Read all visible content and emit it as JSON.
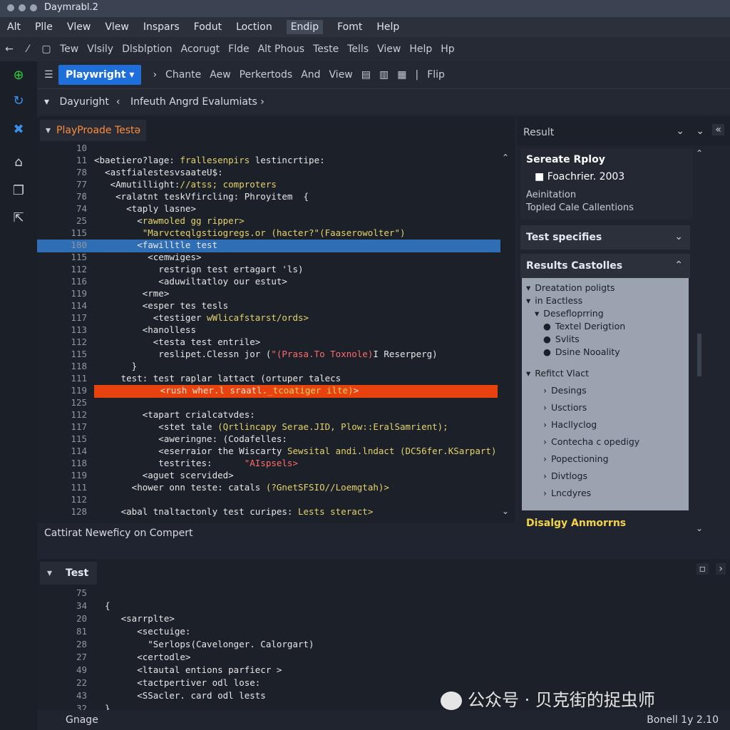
{
  "window": {
    "title": "Daymrabl.2"
  },
  "menu": [
    "Alt",
    "Plle",
    "Vlew",
    "Vlew",
    "Inspars",
    "Fodut",
    "Loction",
    "Endip",
    "Fomt",
    "Help"
  ],
  "toolbar2": [
    "Tew",
    "Vlsily",
    "Dlsblption",
    "Acorugt",
    "Flde",
    "Alt Phous",
    "Teste",
    "Tells",
    "View",
    "Help",
    "Hp"
  ],
  "toolbar3": {
    "project": "Playwright",
    "items": [
      "Chante",
      "Aew",
      "Perkertods",
      "And",
      "View"
    ],
    "flip": "Flip"
  },
  "breadcrumb": {
    "first": "Dayuright",
    "second": "Infeuth Angrd Evalumiats"
  },
  "editor": {
    "tab": "PlayProade Testə",
    "footer": "Cattirat Neweficy on Compert",
    "lines": [
      {
        "n": "10",
        "t": ""
      },
      {
        "n": "11",
        "t": "<baetiero?lage: ",
        "y": "frallesenpirs",
        "t2": " lestincrtipe:"
      },
      {
        "n": "78",
        "t": "  <astfialestesvsaateU$:"
      },
      {
        "n": "77",
        "t": "   <Amutillight:",
        "y": "//atss; comproters"
      },
      {
        "n": "7ϐ",
        "t": "    <ralatnt teskVfircling: Phroyitem  {"
      },
      {
        "n": "74",
        "t": "      <taply lasne>"
      },
      {
        "n": "25",
        "t": "        <",
        "y": "rawmoled gg ripper>"
      },
      {
        "n": "115",
        "t": "         ",
        "y": "\"Marvcteqlgstiogregs.or (hacter?\"(Faaserowolter\")"
      },
      {
        "n": "180",
        "t": "        <fawilltle test",
        "sel": true
      },
      {
        "n": "115",
        "t": "          <cemwiges>"
      },
      {
        "n": "112",
        "t": "            restrign test ertagart 'ls)"
      },
      {
        "n": "116",
        "t": "            <aduwiltatloy our estut>"
      },
      {
        "n": "119",
        "t": "         <rme>"
      },
      {
        "n": "114",
        "t": "         <esper tes tesls"
      },
      {
        "n": "117",
        "t": "           <testiger ",
        "y": "wWlicafstarst/ords>"
      },
      {
        "n": "113",
        "t": "         <hanolless"
      },
      {
        "n": "112",
        "t": "           <testa test entrile>"
      },
      {
        "n": "115",
        "t": "            reslipet.Clessn jor (",
        "r": "\"(Prasa.To Toxnole)",
        "t2": "I Reserperg)"
      },
      {
        "n": "118",
        "t": "       }"
      },
      {
        "n": "111",
        "t": "     test: test raplar lattact (ortuper talecs"
      },
      {
        "n": "119",
        "t": "       <rush wher.l sraatl.",
        "y": "_tcoatiger ilte)",
        "t2": ">",
        "err": true
      },
      {
        "n": "125",
        "t": ""
      },
      {
        "n": "112",
        "t": "         <tapart crialcatvdes:"
      },
      {
        "n": "117",
        "t": "            <stet tale ",
        "y": "(Qrtlincapy Serae.JID, Plow::EralSamrient);"
      },
      {
        "n": "115",
        "t": "            <aweringne: (Codafelles:"
      },
      {
        "n": "114",
        "t": "            <eserraior the Wiscarty ",
        "y": "Sewsital andi.lndact (DC56fer.KSarpart)"
      },
      {
        "n": "118",
        "t": "            testrites:      ",
        "r": "\"AIspsels>"
      },
      {
        "n": "119",
        "t": "         <aguet scervided>"
      },
      {
        "n": "111",
        "t": "       <hower onn teste: catals ",
        "y": "(?GnetSFSIO//Loemgtah)>"
      },
      {
        "n": "112",
        "t": ""
      },
      {
        "n": "128",
        "t": "     <abal tnaltactonly test curipes: ",
        "y": "Lests steract>"
      }
    ]
  },
  "result": {
    "header": "Result",
    "card_title": "Serеate Rploy",
    "card_sub": "Foachrier. 2003",
    "card_l1": "Aeinitation",
    "card_l2": "Topled Cale Callentions",
    "sec1": "Test specifies",
    "sec2": "Results Castolles",
    "tree": [
      {
        "t": "Dreatation poligts",
        "lvl": 0,
        "m": "▾"
      },
      {
        "t": "in Eactless",
        "lvl": 0,
        "m": "▾"
      },
      {
        "t": "Desefloprring",
        "lvl": 1,
        "m": "▾"
      },
      {
        "t": "Textel Derigtion",
        "lvl": 2,
        "m": "●"
      },
      {
        "t": "Svlits",
        "lvl": 2,
        "m": "●"
      },
      {
        "t": "Dsine Nooality",
        "lvl": 2,
        "m": "●"
      },
      {
        "t": "Refitct Vlact",
        "lvl": 0,
        "m": "▾"
      },
      {
        "t": "Desings",
        "lvl": 2,
        "m": "›"
      },
      {
        "t": "Usctiors",
        "lvl": 2,
        "m": "›"
      },
      {
        "t": "Hacllyclog",
        "lvl": 2,
        "m": "›"
      },
      {
        "t": "Contecha c opedigy",
        "lvl": 2,
        "m": "›"
      },
      {
        "t": "Popectioning",
        "lvl": 2,
        "m": "›"
      },
      {
        "t": "Divtlogs",
        "lvl": 2,
        "m": "›"
      },
      {
        "t": "Lncdyres",
        "lvl": 2,
        "m": "›"
      }
    ],
    "footer": "Disalgy Anmorrns"
  },
  "bottom": {
    "tab": "Test",
    "lines": [
      {
        "n": "75",
        "t": ""
      },
      {
        "n": "34",
        "t": "  {"
      },
      {
        "n": "20",
        "t": "     <sarrplte>"
      },
      {
        "n": "81",
        "t": "        <sectuige:"
      },
      {
        "n": "28",
        "t": "          \"Serlops(Cavelonger. Calorgart)"
      },
      {
        "n": "27",
        "t": "        <certodle>"
      },
      {
        "n": "49",
        "t": "        <ltautal entions parfiecr >"
      },
      {
        "n": "22",
        "t": "        <tactpertiver odl lose:"
      },
      {
        "n": "43",
        "t": "        <SSacler. card odl lests"
      },
      {
        "n": "32",
        "t": "  }"
      }
    ],
    "status_left": "Gnage",
    "status_right": "Bonell 1y 2.10"
  },
  "watermark": "公众号 · 贝克街的捉虫师"
}
